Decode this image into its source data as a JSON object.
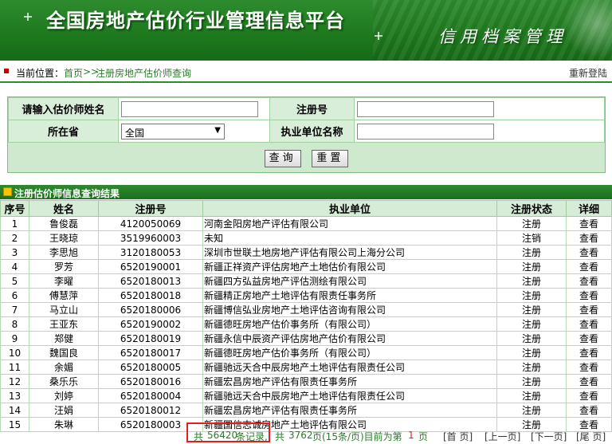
{
  "banner": {
    "title": "全国房地产估价行业管理信息平台",
    "subtitle": "信用档案管理"
  },
  "breadcrumb": {
    "label": "当前位置：",
    "home": "首页",
    "sep": ">>",
    "current": "注册房地产估价师查询",
    "relogin": "重新登陆"
  },
  "search": {
    "name_label": "请输入估价师姓名",
    "name_value": "",
    "reg_label": "注册号",
    "reg_value": "",
    "province_label": "所在省",
    "province_value": "全国",
    "unit_label": "执业单位名称",
    "unit_value": "",
    "query_button": "查询",
    "reset_button": "重置"
  },
  "results": {
    "title": "注册估价师信息查询结果",
    "columns": [
      "序号",
      "姓名",
      "注册号",
      "执业单位",
      "注册状态",
      "详细"
    ],
    "rows": [
      [
        "1",
        "鲁俊磊",
        "4120050069",
        "河南金阳房地产评估有限公司",
        "注册",
        "查看"
      ],
      [
        "2",
        "王晓琼",
        "3519960003",
        "未知",
        "注销",
        "查看"
      ],
      [
        "3",
        "李思旭",
        "3120180053",
        "深圳市世联土地房地产评估有限公司上海分公司",
        "注册",
        "查看"
      ],
      [
        "4",
        "罗芳",
        "6520190001",
        "新疆正祥资产评估房地产土地估价有限公司",
        "注册",
        "查看"
      ],
      [
        "5",
        "李曜",
        "6520180013",
        "新疆四方弘益房地产评估测绘有限公司",
        "注册",
        "查看"
      ],
      [
        "6",
        "傅慧萍",
        "6520180018",
        "新疆精正房地产土地评估有限责任事务所",
        "注册",
        "查看"
      ],
      [
        "7",
        "马立山",
        "6520180006",
        "新疆博信弘业房地产土地评估咨询有限公司",
        "注册",
        "查看"
      ],
      [
        "8",
        "王亚东",
        "6520190002",
        "新疆德旺房地产估价事务所（有限公司）",
        "注册",
        "查看"
      ],
      [
        "9",
        "郑健",
        "6520180019",
        "新疆永信中辰资产评估房地产估价有限公司",
        "注册",
        "查看"
      ],
      [
        "10",
        "魏国良",
        "6520180017",
        "新疆德旺房地产估价事务所（有限公司）",
        "注册",
        "查看"
      ],
      [
        "11",
        "余媚",
        "6520180005",
        "新疆驰远天合中辰房地产土地评估有限责任公司",
        "注册",
        "查看"
      ],
      [
        "12",
        "桑乐乐",
        "6520180016",
        "新疆宏昌房地产评估有限责任事务所",
        "注册",
        "查看"
      ],
      [
        "13",
        "刘婷",
        "6520180004",
        "新疆驰远天合中辰房地产土地评估有限责任公司",
        "注册",
        "查看"
      ],
      [
        "14",
        "汪娟",
        "6520180012",
        "新疆宏昌房地产评估有限责任事务所",
        "注册",
        "查看"
      ],
      [
        "15",
        "朱琳",
        "6520180003",
        "新疆国信志诚房地产土地评估有限公司",
        "注册",
        "查看"
      ]
    ]
  },
  "pager": {
    "total_prefix": "共",
    "total_count": "56420",
    "total_suffix": "条记录,",
    "pages_prefix": "共",
    "pages_count": "3762",
    "pages_suffix": "页(15条/页)目前为第",
    "current_page": "1",
    "page_suffix": "页",
    "first": "[首 页]",
    "prev": "[上一页]",
    "next": "[下一页]",
    "last": "[尾 页]"
  },
  "colors": {
    "accent_green": "#2e8b2e",
    "highlight_red": "#e0201f"
  }
}
